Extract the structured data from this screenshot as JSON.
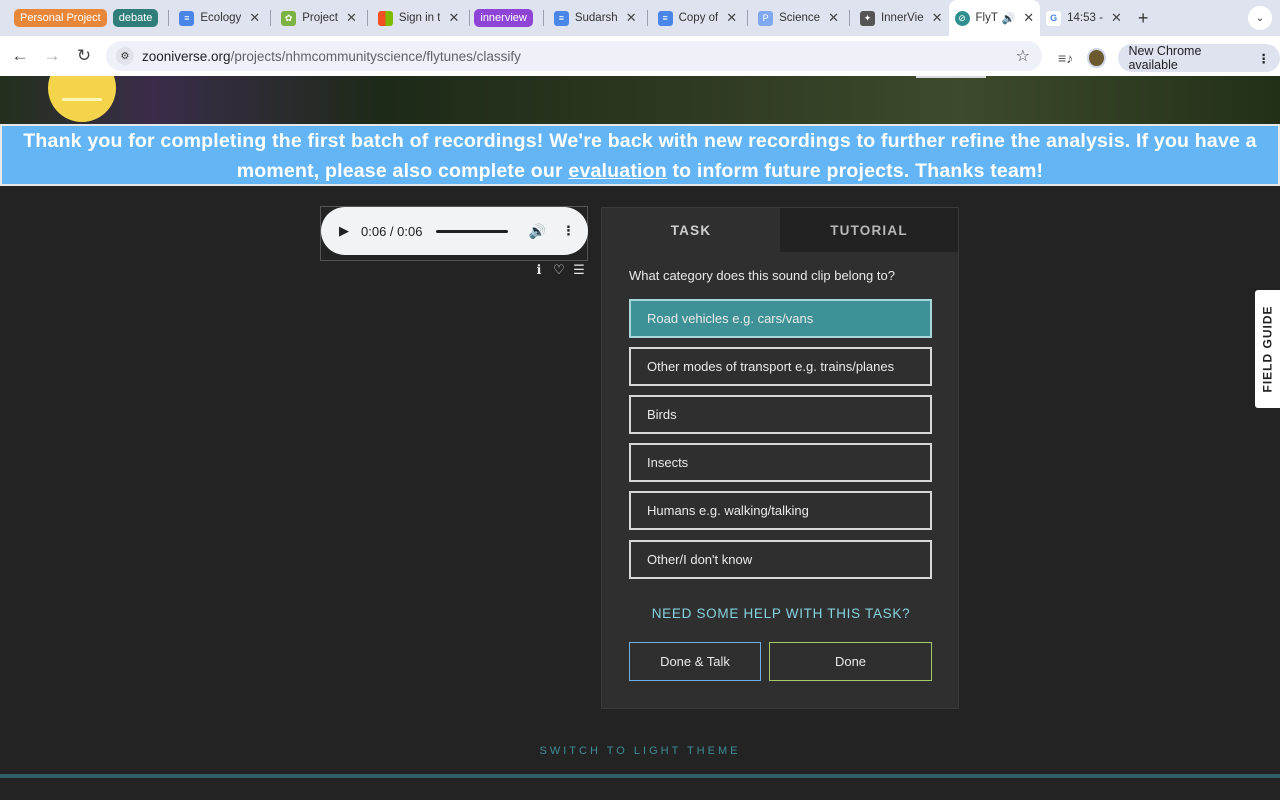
{
  "browser": {
    "tab_groups": [
      {
        "label": "Personal Project",
        "color": "#e8863a"
      },
      {
        "label": "debate",
        "color": "#2f7e7a"
      }
    ],
    "tabs_a": [
      {
        "title": "Ecology",
        "fav_color": "#4a86e8"
      },
      {
        "title": "Project",
        "fav_color": "#7cb342"
      },
      {
        "title": "Sign in t",
        "fav_color": "#f25022"
      }
    ],
    "group_innerview": {
      "label": "innerview",
      "color": "#8e44d6"
    },
    "tabs_b": [
      {
        "title": "Sudarsh",
        "fav_color": "#4a86e8"
      },
      {
        "title": "Copy of",
        "fav_color": "#4a86e8"
      },
      {
        "title": "Science",
        "fav_color": "#7ea8f0"
      },
      {
        "title": "InnerVie",
        "fav_color": "#555555"
      }
    ],
    "active_tab": {
      "title": "FlyTu",
      "fav_color": "#2f8f8f"
    },
    "last_tab": {
      "title": "14:53 -",
      "fav_color": "#4285f4"
    },
    "url_host": "zooniverse.org",
    "url_path": "/projects/nhmcommunityscience/flytunes/classify",
    "update_label": "New Chrome available"
  },
  "banner": {
    "text_before": "Thank you for completing the first batch of recordings! We're back with new recordings to further refine the analysis. If you have a moment, please also complete our ",
    "link": "evaluation",
    "text_after": " to inform future projects. Thanks team!"
  },
  "audio": {
    "time": "0:06 / 0:06"
  },
  "panel": {
    "tab_task": "TASK",
    "tab_tutorial": "TUTORIAL",
    "question": "What category does this sound clip belong to?",
    "answers": [
      "Road vehicles e.g. cars/vans",
      "Other modes of transport e.g. trains/planes",
      "Birds",
      "Insects",
      "Humans e.g. walking/talking",
      "Other/I don't know"
    ],
    "help": "NEED SOME HELP WITH THIS TASK?",
    "done_talk": "Done & Talk",
    "done": "Done"
  },
  "field_guide": "FIELD GUIDE",
  "theme_link": "SWITCH TO LIGHT THEME",
  "icons": [
    "info-icon",
    "heart-icon",
    "list-icon",
    "play-icon",
    "volume-icon",
    "more-icon"
  ]
}
